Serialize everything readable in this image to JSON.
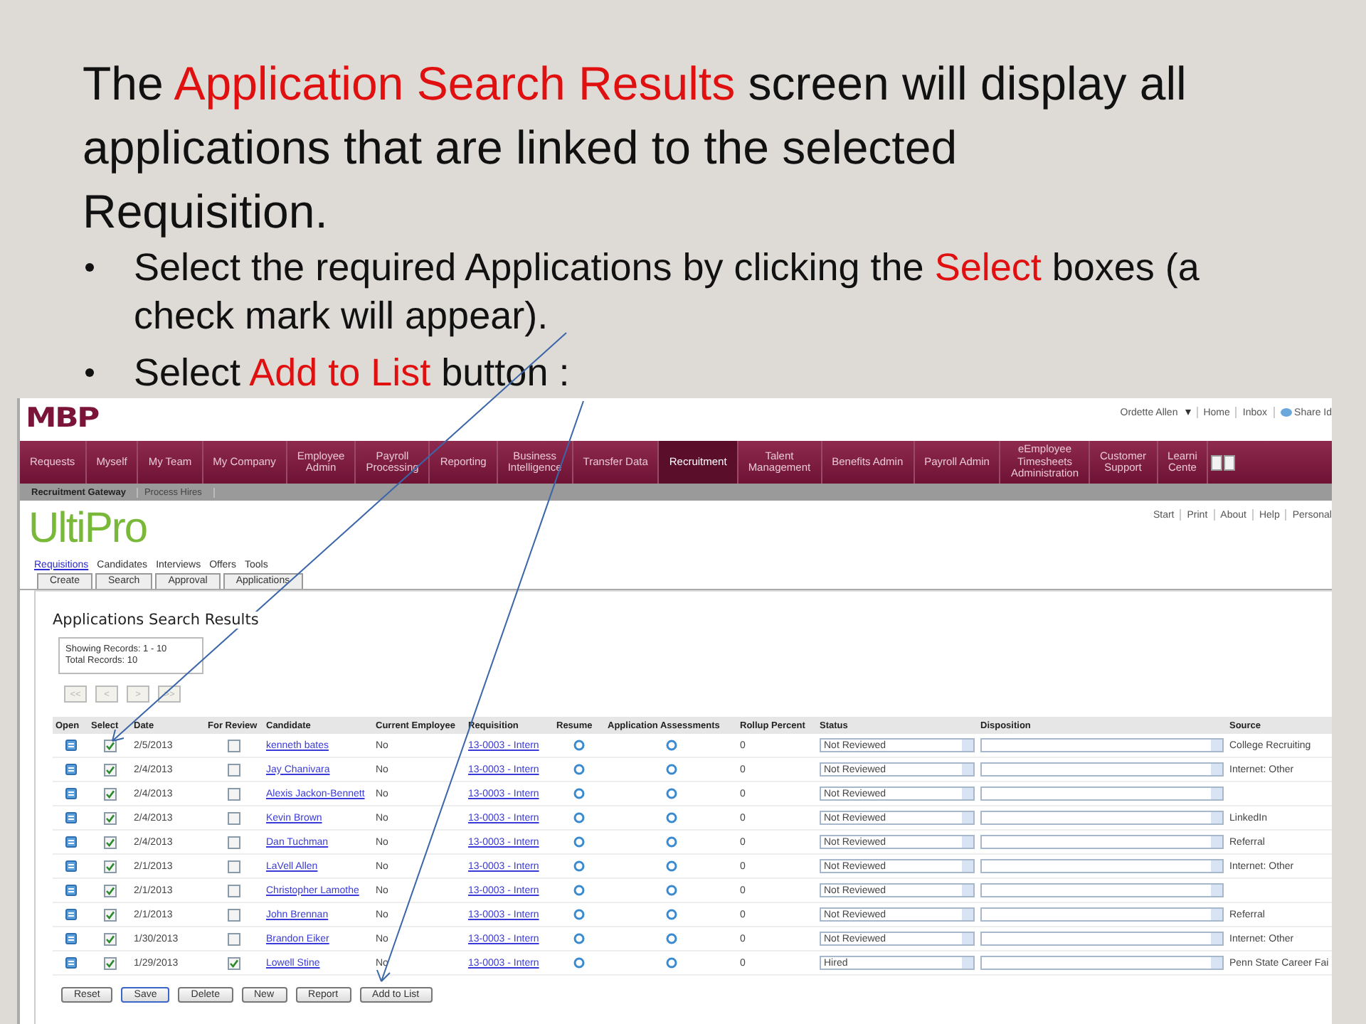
{
  "slide": {
    "title": [
      {
        "text": "The ",
        "highlight": false
      },
      {
        "text": "Application Search Results",
        "highlight": true
      },
      {
        "text": " screen will display all applications that are linked to the selected Requisition.",
        "highlight": false
      }
    ],
    "bullets": [
      [
        {
          "text": "Select the required Applications by clicking the ",
          "highlight": false
        },
        {
          "text": "Select",
          "highlight": true
        },
        {
          "text": " boxes (a check mark will appear).",
          "highlight": false
        }
      ],
      [
        {
          "text": "Select ",
          "highlight": false
        },
        {
          "text": "Add to List",
          "highlight": true
        },
        {
          "text": " button :",
          "highlight": false
        }
      ]
    ]
  },
  "app": {
    "logo": "MBP",
    "user_links": [
      {
        "label": "Ordette Allen",
        "kind": "menu"
      },
      {
        "label": "Home",
        "kind": "link"
      },
      {
        "label": "Inbox",
        "kind": "link"
      },
      {
        "label": "Share Id",
        "kind": "share"
      }
    ],
    "nav": [
      {
        "lines": [
          "Requests"
        ],
        "selected": false
      },
      {
        "lines": [
          "Myself"
        ],
        "selected": false
      },
      {
        "lines": [
          "My Team"
        ],
        "selected": false
      },
      {
        "lines": [
          "My Company"
        ],
        "selected": false
      },
      {
        "lines": [
          "Employee",
          "Admin"
        ],
        "selected": false
      },
      {
        "lines": [
          "Payroll",
          "Processing"
        ],
        "selected": false
      },
      {
        "lines": [
          "Reporting"
        ],
        "selected": false
      },
      {
        "lines": [
          "Business",
          "Intelligence"
        ],
        "selected": false
      },
      {
        "lines": [
          "Transfer Data"
        ],
        "selected": false
      },
      {
        "lines": [
          "Recruitment"
        ],
        "selected": true
      },
      {
        "lines": [
          "Talent",
          "Management"
        ],
        "selected": false
      },
      {
        "lines": [
          "Benefits Admin"
        ],
        "selected": false
      },
      {
        "lines": [
          "Payroll Admin"
        ],
        "selected": false
      },
      {
        "lines": [
          "eEmployee",
          "Timesheets",
          "Administration"
        ],
        "selected": false
      },
      {
        "lines": [
          "Customer",
          "Support"
        ],
        "selected": false
      },
      {
        "lines": [
          "Learni",
          "Cente"
        ],
        "selected": false
      }
    ],
    "subnav": [
      {
        "label": "Recruitment Gateway",
        "selected": true
      },
      {
        "label": "Process Hires",
        "selected": false
      }
    ],
    "product_logo": "UltiPro",
    "utility_links": [
      "Start",
      "Print",
      "About",
      "Help",
      "Personal"
    ],
    "sections": [
      {
        "label": "Requisitions",
        "selected": true
      },
      {
        "label": "Candidates",
        "selected": false
      },
      {
        "label": "Interviews",
        "selected": false
      },
      {
        "label": "Offers",
        "selected": false
      },
      {
        "label": "Tools",
        "selected": false
      }
    ],
    "subtabs": [
      "Create",
      "Search",
      "Approval",
      "Applications"
    ],
    "panel_title": "Applications Search Results",
    "records": [
      "Showing Records:  1 - 10",
      "Total Records:  10"
    ],
    "pager": [
      {
        "label": "<<",
        "disabled": true
      },
      {
        "label": "<",
        "disabled": true
      },
      {
        "label": ">",
        "disabled": true
      },
      {
        "label": ">>",
        "disabled": true
      }
    ],
    "table": {
      "columns": [
        "Open",
        "Select",
        "Date",
        "For Review",
        "Candidate",
        "Current Employee",
        "Requisition",
        "Resume",
        "Application Assessments",
        "Rollup Percent",
        "Status",
        "Disposition",
        "Source"
      ],
      "rows": [
        {
          "select": {
            "checked": true
          },
          "date": "2/5/2013",
          "for_review": {
            "checked": false
          },
          "candidate": "kenneth bates",
          "current_employee": "No",
          "requisition": "13-0003 - Intern",
          "rollup": "0",
          "status": "Not Reviewed",
          "source": "College Recruiting"
        },
        {
          "select": {
            "checked": true
          },
          "date": "2/4/2013",
          "for_review": {
            "checked": false
          },
          "candidate": "Jay Chanivara",
          "current_employee": "No",
          "requisition": "13-0003 - Intern",
          "rollup": "0",
          "status": "Not Reviewed",
          "source": "Internet: Other"
        },
        {
          "select": {
            "checked": true
          },
          "date": "2/4/2013",
          "for_review": {
            "checked": false
          },
          "candidate": "Alexis Jackon-Bennett",
          "current_employee": "No",
          "requisition": "13-0003 - Intern",
          "rollup": "0",
          "status": "Not Reviewed"
        },
        {
          "select": {
            "checked": true
          },
          "date": "2/4/2013",
          "for_review": {
            "checked": false
          },
          "candidate": "Kevin Brown",
          "current_employee": "No",
          "requisition": "13-0003 - Intern",
          "rollup": "0",
          "status": "Not Reviewed",
          "source": "LinkedIn"
        },
        {
          "select": {
            "checked": true
          },
          "date": "2/4/2013",
          "for_review": {
            "checked": false
          },
          "candidate": "Dan Tuchman",
          "current_employee": "No",
          "requisition": "13-0003 - Intern",
          "rollup": "0",
          "status": "Not Reviewed",
          "source": "Referral"
        },
        {
          "select": {
            "checked": true
          },
          "date": "2/1/2013",
          "for_review": {
            "checked": false
          },
          "candidate": "LaVell Allen",
          "current_employee": "No",
          "requisition": "13-0003 - Intern",
          "rollup": "0",
          "status": "Not Reviewed",
          "source": "Internet: Other"
        },
        {
          "select": {
            "checked": true
          },
          "date": "2/1/2013",
          "for_review": {
            "checked": false
          },
          "candidate": "Christopher Lamothe",
          "current_employee": "No",
          "requisition": "13-0003 - Intern",
          "rollup": "0",
          "status": "Not Reviewed"
        },
        {
          "select": {
            "checked": true
          },
          "date": "2/1/2013",
          "for_review": {
            "checked": false
          },
          "candidate": "John Brennan",
          "current_employee": "No",
          "requisition": "13-0003 - Intern",
          "rollup": "0",
          "status": "Not Reviewed",
          "source": "Referral"
        },
        {
          "select": {
            "checked": true
          },
          "date": "1/30/2013",
          "for_review": {
            "checked": false
          },
          "candidate": "Brandon Eiker",
          "current_employee": "No",
          "requisition": "13-0003 - Intern",
          "rollup": "0",
          "status": "Not Reviewed",
          "source": "Internet: Other"
        },
        {
          "select": {
            "checked": true
          },
          "date": "1/29/2013",
          "for_review": {
            "checked": true
          },
          "candidate": "Lowell Stine",
          "current_employee": "No",
          "requisition": "13-0003 - Intern",
          "rollup": "0",
          "status": "Hired",
          "source": "Penn State Career Fai"
        }
      ]
    },
    "buttons": [
      {
        "label": "Reset",
        "focused": false
      },
      {
        "label": "Save",
        "focused": true
      },
      {
        "label": "Delete",
        "focused": false
      },
      {
        "label": "New",
        "focused": false
      },
      {
        "label": "Report",
        "focused": false
      },
      {
        "label": "Add to List",
        "focused": false
      }
    ]
  }
}
